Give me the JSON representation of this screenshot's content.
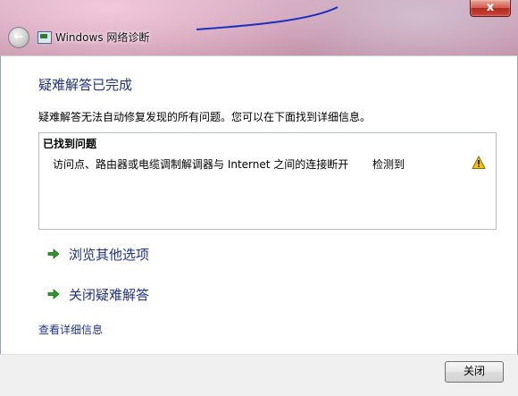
{
  "window": {
    "title": "Windows 网络诊断",
    "close_glyph": "x",
    "back_glyph": "←"
  },
  "main": {
    "heading": "疑难解答已完成",
    "description": "疑难解答无法自动修复发现的所有问题。您可以在下面找到详细信息。",
    "problems": {
      "header": "已找到问题",
      "items": [
        {
          "text": "访问点、路由器或电缆调制解调器与 Internet 之间的连接断开",
          "status": "检测到",
          "icon": "warning-icon"
        }
      ]
    },
    "links": [
      {
        "label": "浏览其他选项",
        "icon": "green-arrow-icon"
      },
      {
        "label": "关闭疑难解答",
        "icon": "green-arrow-icon"
      }
    ],
    "details_link": "查看详细信息"
  },
  "footer": {
    "close_label": "关闭"
  },
  "colors": {
    "link_blue": "#1e3287",
    "arrow_green": "#2e9a2e",
    "warning_yellow": "#f5c400"
  }
}
